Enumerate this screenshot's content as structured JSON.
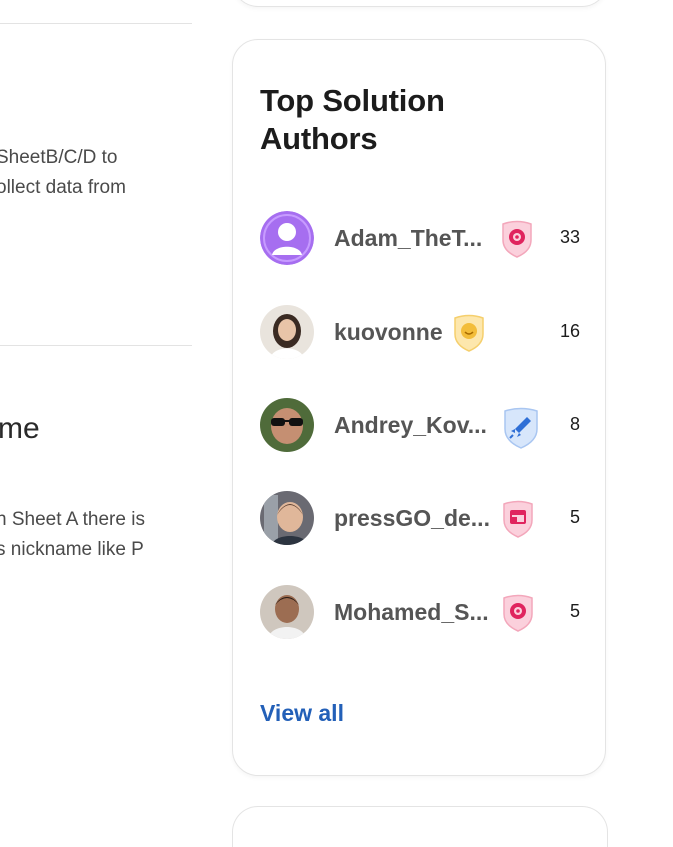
{
  "left": {
    "text_lines_1": [
      "SheetB/C/D to",
      "ollect data from"
    ],
    "title": "me",
    "text_lines_2": [
      "n Sheet A there is",
      "s nickname like P"
    ]
  },
  "card": {
    "title": "Top Solution Authors",
    "authors": [
      {
        "name": "Adam_TheT...",
        "count": "33",
        "badge_icon": "target-badge-icon",
        "badge_color": "#e0245e"
      },
      {
        "name": "kuovonne",
        "count": "16",
        "badge_icon": "smile-badge-icon",
        "badge_color": "#e3a31a"
      },
      {
        "name": "Andrey_Kov...",
        "count": "8",
        "badge_icon": "rocket-badge-icon",
        "badge_color": "#2f6fd6"
      },
      {
        "name": "pressGO_de...",
        "count": "5",
        "badge_icon": "browser-badge-icon",
        "badge_color": "#e0245e"
      },
      {
        "name": "Mohamed_S...",
        "count": "5",
        "badge_icon": "target-badge-icon",
        "badge_color": "#e0245e"
      }
    ],
    "view_all_label": "View all"
  },
  "colors": {
    "link": "#2360b8",
    "name_text": "#555555",
    "default_avatar": "#a66ef0"
  }
}
